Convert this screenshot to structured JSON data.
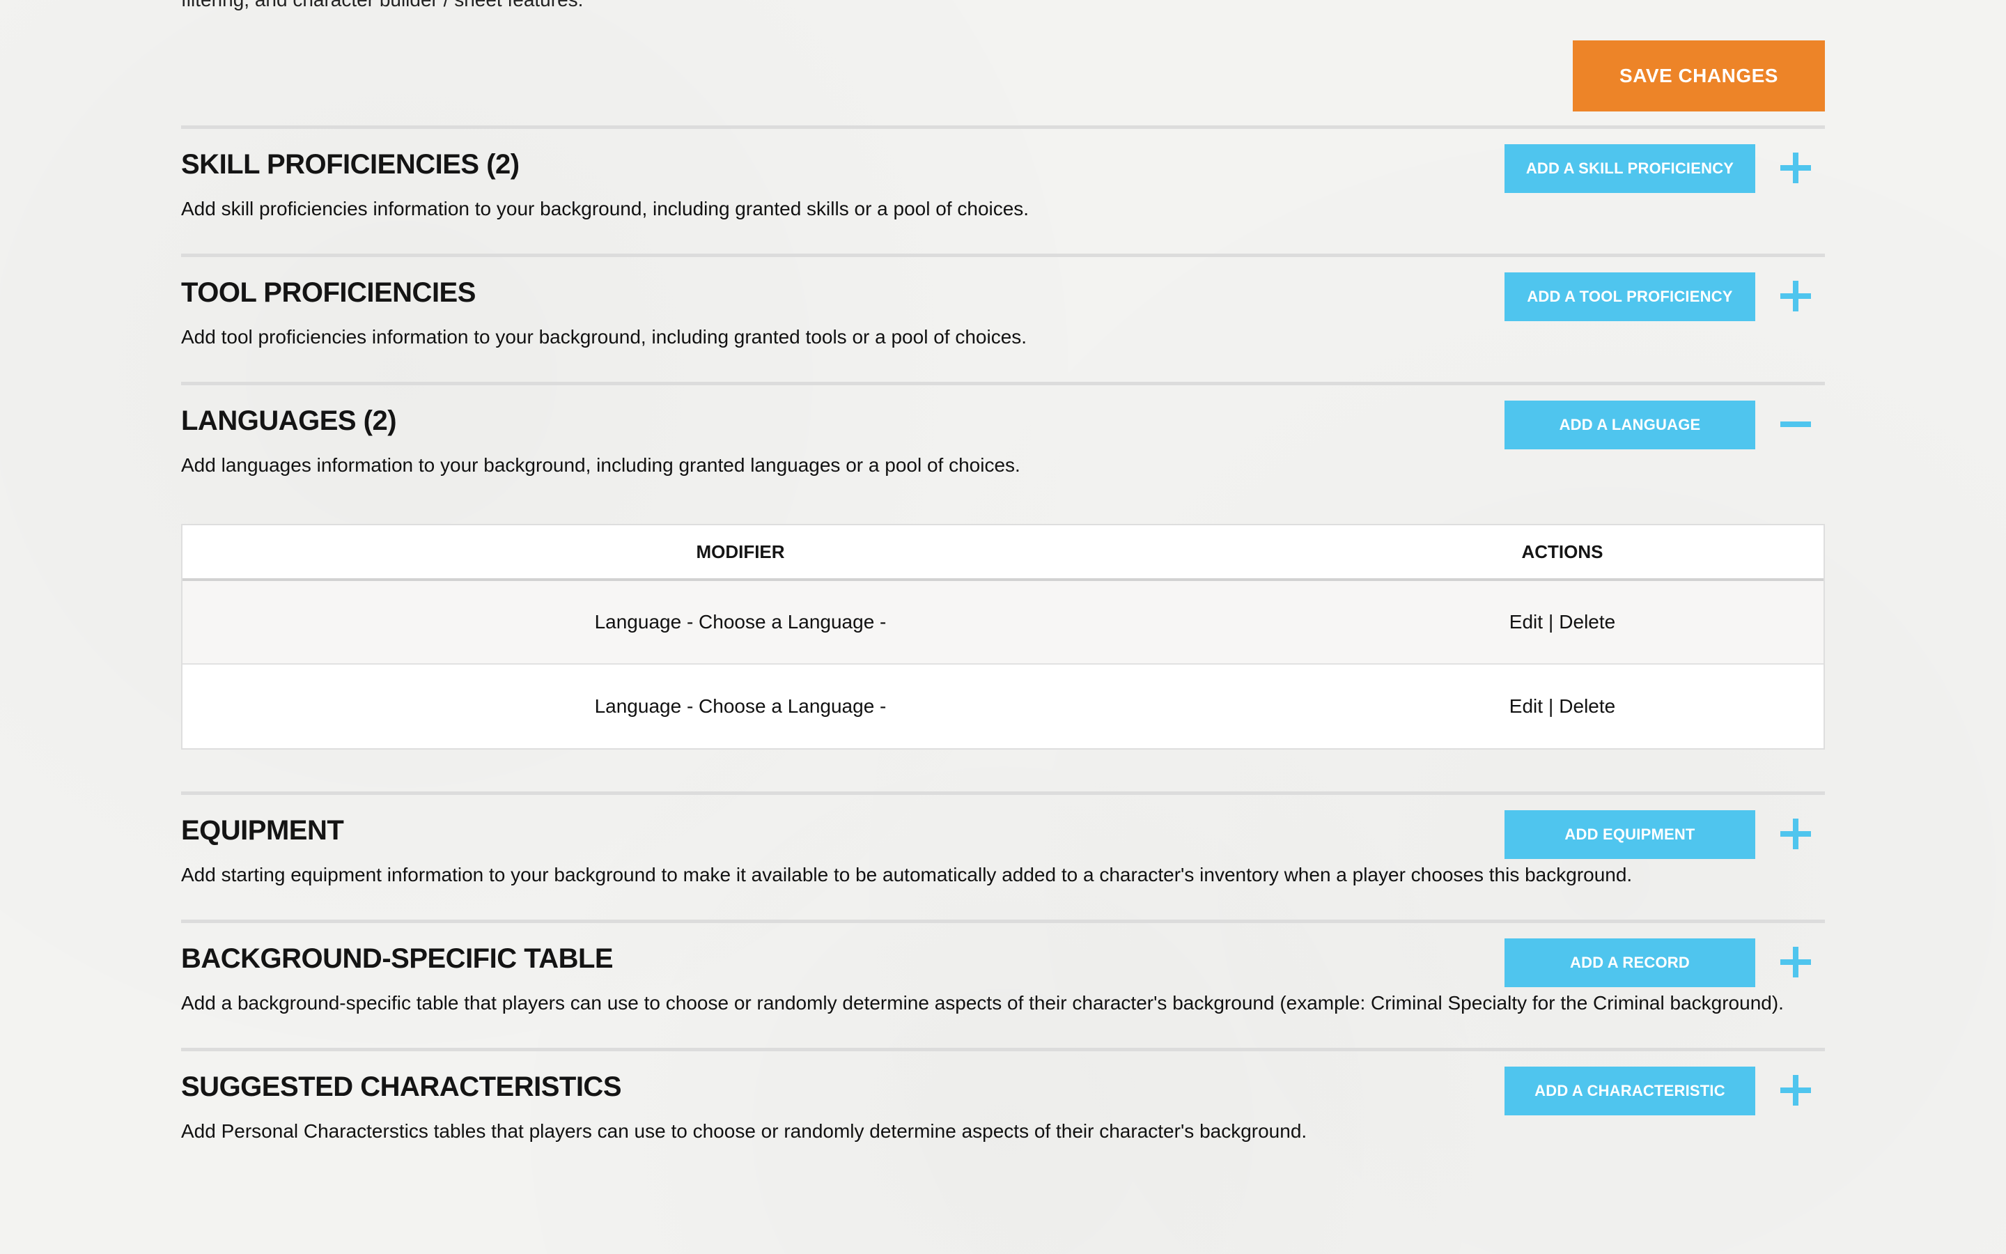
{
  "intro_cutoff_text": "filtering, and character builder / sheet features.",
  "save_button_label": "SAVE CHANGES",
  "sections": [
    {
      "title": "SKILL PROFICIENCIES (2)",
      "description": "Add skill proficiencies information to your background, including granted skills or a pool of choices.",
      "button_label": "ADD A SKILL PROFICIENCY",
      "toggle_icon": "plus-icon"
    },
    {
      "title": "TOOL PROFICIENCIES",
      "description": "Add tool proficiencies information to your background, including granted tools or a pool of choices.",
      "button_label": "ADD A TOOL PROFICIENCY",
      "toggle_icon": "plus-icon"
    },
    {
      "title": "LANGUAGES (2)",
      "description": "Add languages information to your background, including granted languages or a pool of choices.",
      "button_label": "ADD A LANGUAGE",
      "toggle_icon": "minus-icon",
      "table": {
        "headers": [
          "MODIFIER",
          "ACTIONS"
        ],
        "rows": [
          {
            "modifier": "Language - Choose a Language -",
            "edit": "Edit",
            "separator": "|",
            "delete": "Delete"
          },
          {
            "modifier": "Language - Choose a Language -",
            "edit": "Edit",
            "separator": "|",
            "delete": "Delete"
          }
        ]
      }
    },
    {
      "title": "EQUIPMENT",
      "description": "Add starting equipment information to your background to make it available to be automatically added to a character's inventory when a player chooses this background.",
      "button_label": "ADD EQUIPMENT",
      "toggle_icon": "plus-icon"
    },
    {
      "title": "BACKGROUND-SPECIFIC TABLE",
      "description": "Add a background-specific table that players can use to choose or randomly determine aspects of their character's background (example: Criminal Specialty for the Criminal background).",
      "button_label": "ADD A RECORD",
      "toggle_icon": "plus-icon"
    },
    {
      "title": "SUGGESTED CHARACTERISTICS",
      "description": "Add Personal Characterstics tables that players can use to choose or randomly determine aspects of their character's background.",
      "button_label": "ADD A CHARACTERISTIC",
      "toggle_icon": "plus-icon"
    }
  ],
  "colors": {
    "accent_blue": "#4fc5ee",
    "save_orange": "#ed8428",
    "divider_gray": "#dcdcdc"
  }
}
